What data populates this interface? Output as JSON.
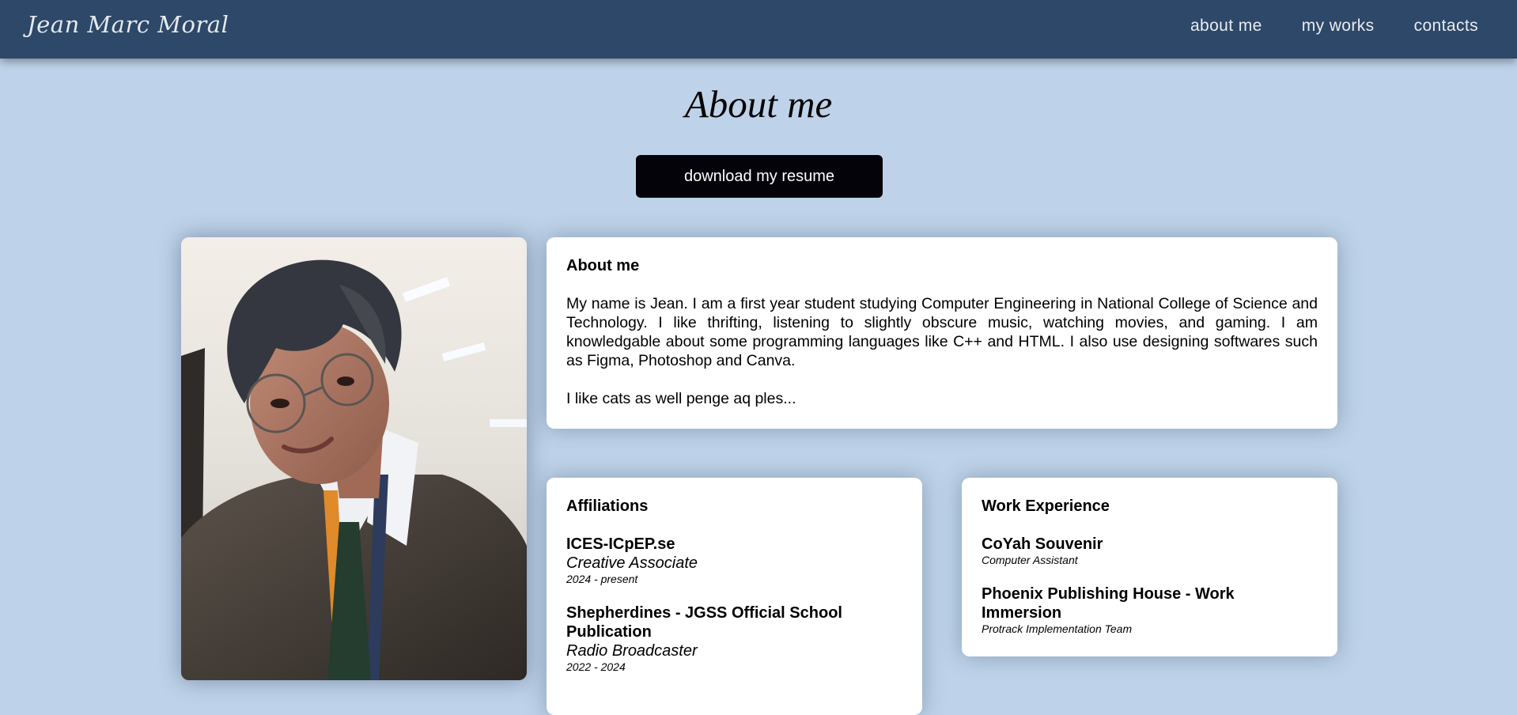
{
  "header": {
    "logo": "Jean Marc Moral",
    "nav": [
      "about me",
      "my works",
      "contacts"
    ]
  },
  "main": {
    "title": "About me",
    "resume_button": "download my resume"
  },
  "about": {
    "heading": "About me",
    "paragraph1": "My name is Jean. I am a first year student studying Computer Engineering in National College of Science and Technology. I like thrifting, listening to slightly obscure music, watching movies, and gaming. I am knowledgable about some programming languages like C++ and HTML. I also use designing softwares such as Figma, Photoshop and Canva.",
    "paragraph2": "I like cats as well penge aq ples..."
  },
  "affiliations": {
    "heading": "Affiliations",
    "items": [
      {
        "org": "ICES-ICpEP.se",
        "role": "Creative Associate",
        "years": "2024 - present"
      },
      {
        "org": "Shepherdines - JGSS Official School Publication",
        "role": "Radio Broadcaster",
        "years": "2022 - 2024"
      }
    ]
  },
  "work": {
    "heading": "Work Experience",
    "items": [
      {
        "org": "CoYah Souvenir",
        "role": "Computer Assistant"
      },
      {
        "org": "Phoenix Publishing House - Work Immersion",
        "role": "Protrack Implementation Team"
      }
    ]
  },
  "colors": {
    "background": "#bed3e9",
    "header": "#2d4868",
    "button": "#05030a",
    "card": "#ffffff"
  }
}
